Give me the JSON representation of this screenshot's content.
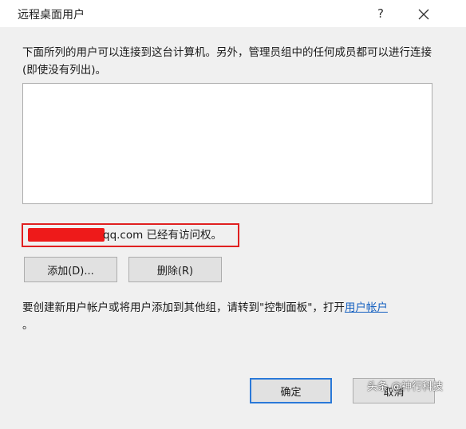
{
  "window": {
    "title": "远程桌面用户",
    "help_label": "?",
    "close_icon": "close-icon"
  },
  "dialog": {
    "description": "下面所列的用户可以连接到这台计算机。另外，管理员组中的任何成员都可以进行连接(即使没有列出)。",
    "user_list_items": [],
    "access_message": "qq.com 已经有访问权。",
    "redaction_color": "#ee1a1a",
    "highlight_color": "#e02020",
    "buttons": {
      "add": "添加(D)...",
      "remove": "删除(R)",
      "ok": "确定",
      "cancel": "取消"
    },
    "hint_text": "要创建新用户帐户或将用户添加到其他组，请转到\"控制面板\"，打开",
    "hint_link": "用户帐户",
    "hint_end": "。"
  },
  "watermark": "头条 @神行科技"
}
